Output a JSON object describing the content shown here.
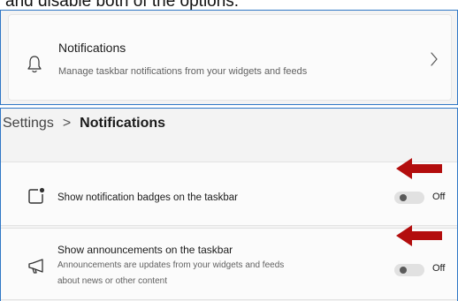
{
  "caption": "and disable both of the options:",
  "notifications_card": {
    "title": "Notifications",
    "subtitle": "Manage taskbar notifications from your widgets and feeds",
    "icon": "bell-icon",
    "chevron_icon": "chevron-right-icon"
  },
  "breadcrumb": {
    "root": "Settings",
    "separator": ">",
    "current": "Notifications"
  },
  "settings": [
    {
      "icon": "notification-badge-icon",
      "label": "Show notification badges on the taskbar",
      "toggle_state": "Off",
      "enabled": false
    },
    {
      "icon": "megaphone-icon",
      "label": "Show announcements on the taskbar",
      "description_line1": "Announcements are updates from your widgets and feeds",
      "description_line2": "about news or other content",
      "toggle_state": "Off",
      "enabled": false
    }
  ],
  "colors": {
    "accent_border": "#2f77c6",
    "annotation_arrow": "#b30d0d"
  }
}
